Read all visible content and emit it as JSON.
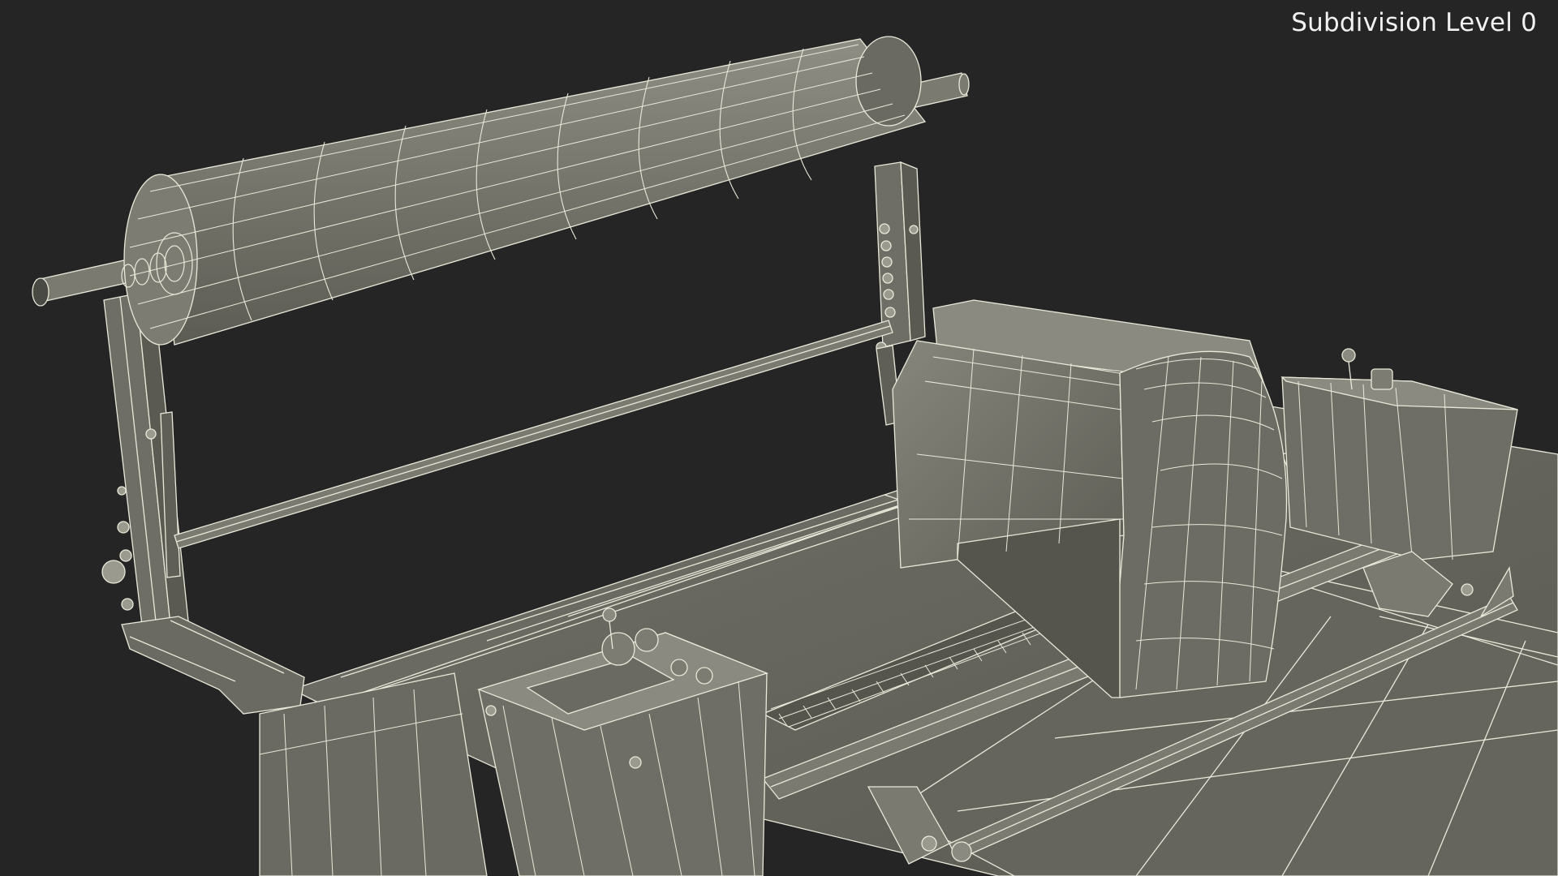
{
  "overlay": {
    "subdivision_label": "Subdivision Level 0"
  },
  "colors": {
    "background": "#252525",
    "mesh_fill": "#74746b",
    "mesh_fill_light": "#8a8a80",
    "mesh_fill_dark": "#5d5d55",
    "wire": "#e9e9da",
    "label_text": "#f2f2f2"
  },
  "scene": {
    "subject": "wireframe 3D model of dough sheeter machine"
  }
}
